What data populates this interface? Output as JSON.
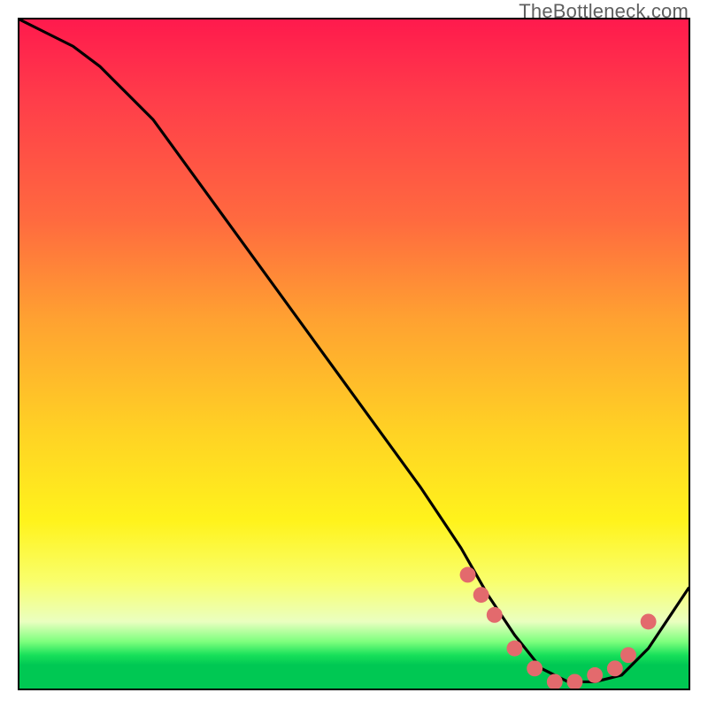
{
  "watermark": "TheBottleneck.com",
  "chart_data": {
    "type": "line",
    "title": "",
    "xlabel": "",
    "ylabel": "",
    "xlim": [
      0,
      100
    ],
    "ylim": [
      0,
      100
    ],
    "series": [
      {
        "name": "curve",
        "x": [
          0,
          4,
          8,
          12,
          16,
          20,
          28,
          36,
          44,
          52,
          60,
          66,
          70,
          74,
          78,
          82,
          86,
          90,
          94,
          98,
          100
        ],
        "y": [
          100,
          98,
          96,
          93,
          89,
          85,
          74,
          63,
          52,
          41,
          30,
          21,
          14,
          8,
          3,
          1,
          1,
          2,
          6,
          12,
          15
        ]
      }
    ],
    "markers": {
      "name": "dots",
      "color": "#e36a6d",
      "radius_px": 9,
      "x": [
        67,
        69,
        71,
        74,
        77,
        80,
        83,
        86,
        89,
        91,
        94
      ],
      "y": [
        17,
        14,
        11,
        6,
        3,
        1,
        1,
        2,
        3,
        5,
        10
      ]
    },
    "background_gradient": {
      "direction": "top-to-bottom",
      "stops": [
        {
          "pos": 0.0,
          "color": "#ff1a4d"
        },
        {
          "pos": 0.3,
          "color": "#ff6a3f"
        },
        {
          "pos": 0.62,
          "color": "#ffd324"
        },
        {
          "pos": 0.84,
          "color": "#f9ff6d"
        },
        {
          "pos": 0.95,
          "color": "#18e05a"
        },
        {
          "pos": 1.0,
          "color": "#00c853"
        }
      ]
    }
  }
}
